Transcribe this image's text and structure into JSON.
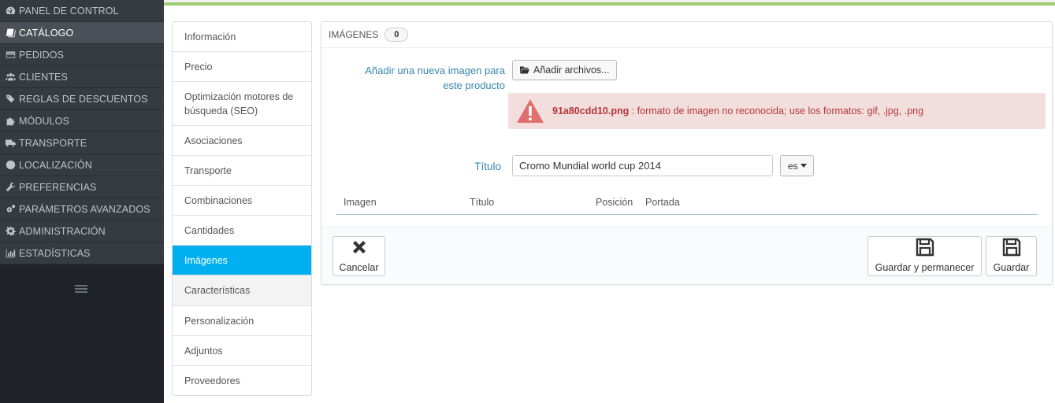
{
  "sidebar": {
    "items": [
      {
        "label": "PANEL DE CONTROL",
        "icon": "dashboard-icon"
      },
      {
        "label": "CATÁLOGO",
        "icon": "book-icon",
        "active": true
      },
      {
        "label": "PEDIDOS",
        "icon": "credit-card-icon"
      },
      {
        "label": "CLIENTES",
        "icon": "users-icon"
      },
      {
        "label": "REGLAS DE DESCUENTOS",
        "icon": "tags-icon"
      },
      {
        "label": "MÓDULOS",
        "icon": "puzzle-icon"
      },
      {
        "label": "TRANSPORTE",
        "icon": "truck-icon"
      },
      {
        "label": "LOCALIZACIÓN",
        "icon": "globe-icon"
      },
      {
        "label": "PREFERENCIAS",
        "icon": "wrench-icon"
      },
      {
        "label": "PARÁMETROS AVANZADOS",
        "icon": "cogs-icon"
      },
      {
        "label": "ADMINISTRACIÓN",
        "icon": "cog-icon"
      },
      {
        "label": "ESTADÍSTICAS",
        "icon": "bar-chart-icon"
      }
    ]
  },
  "tabs": [
    {
      "label": "Información"
    },
    {
      "label": "Precio"
    },
    {
      "label": "Optimización motores de búsqueda (SEO)"
    },
    {
      "label": "Asociaciones"
    },
    {
      "label": "Transporte"
    },
    {
      "label": "Combinaciones"
    },
    {
      "label": "Cantidades"
    },
    {
      "label": "Imágenes",
      "active": true
    },
    {
      "label": "Características"
    },
    {
      "label": "Personalización"
    },
    {
      "label": "Adjuntos"
    },
    {
      "label": "Proveedores"
    }
  ],
  "panel": {
    "heading": "IMÁGENES",
    "count": "0",
    "add_image_label": "Añadir una nueva imagen para este producto",
    "add_files_button": "Añadir archivos...",
    "alert": {
      "filename": "91a80cdd10.png",
      "message": " : formato de imagen no reconocida; use los formatos: gif, .jpg, .png"
    },
    "title_label": "Título",
    "title_value": "Cromo Mundial world cup 2014",
    "lang": "es",
    "columns": {
      "image": "Imagen",
      "title": "Título",
      "position": "Posición",
      "cover": "Portada"
    },
    "footer": {
      "cancel": "Cancelar",
      "save_stay": "Guardar y permanecer",
      "save": "Guardar"
    }
  },
  "colors": {
    "accent": "#00aff0",
    "sidebar": "#363a41",
    "alert_bg": "#f3dede",
    "alert_text": "#b43636",
    "top_bar": "#9fce70"
  }
}
